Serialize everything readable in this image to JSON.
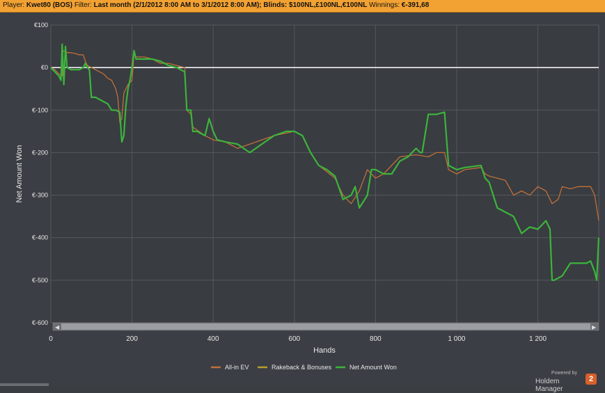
{
  "header": {
    "player_label": "Player:",
    "player_value": "Kwet80 (BOS)",
    "filter_label": "Filter:",
    "filter_value": "Last month (2/1/2012 8:00 AM to 3/1/2012 8:00 AM); Blinds: $100NL,£100NL,€100NL",
    "winnings_label": "Winnings:",
    "winnings_value": "€-391,68"
  },
  "branding": {
    "powered_by": "Powered by",
    "name": "Holdem Manager",
    "logo_glyph": "2"
  },
  "colors": {
    "background": "#3b3e44",
    "grid": "#55585d",
    "zero_line": "#ffffff",
    "all_in_ev": "#c0703a",
    "rakeback": "#b8a02a",
    "net_won": "#3cb43c",
    "header_bar": "#f2a233"
  },
  "chart_data": {
    "type": "line",
    "xlabel": "Hands",
    "ylabel": "Net Amount Won",
    "xlim": [
      0,
      1350
    ],
    "ylim": [
      -600,
      100
    ],
    "x_ticks": [
      0,
      200,
      400,
      600,
      800,
      1000,
      1200
    ],
    "x_tick_labels": [
      "0",
      "200",
      "400",
      "600",
      "800",
      "1 000",
      "1 200"
    ],
    "y_ticks": [
      100,
      0,
      -100,
      -200,
      -300,
      -400,
      -500,
      -600
    ],
    "y_tick_labels": [
      "€100",
      "€0",
      "€-100",
      "€-200",
      "€-300",
      "€-400",
      "€-500",
      "€-600"
    ],
    "grid": true,
    "legend_position": "bottom",
    "series": [
      {
        "name": "All-in EV",
        "color": "#c0703a",
        "points": [
          [
            0,
            0
          ],
          [
            10,
            -5
          ],
          [
            20,
            -15
          ],
          [
            28,
            -20
          ],
          [
            30,
            40
          ],
          [
            40,
            35
          ],
          [
            50,
            35
          ],
          [
            60,
            33
          ],
          [
            70,
            30
          ],
          [
            80,
            30
          ],
          [
            85,
            15
          ],
          [
            90,
            5
          ],
          [
            100,
            0
          ],
          [
            110,
            -5
          ],
          [
            120,
            -10
          ],
          [
            130,
            -15
          ],
          [
            140,
            -25
          ],
          [
            150,
            -30
          ],
          [
            160,
            -50
          ],
          [
            165,
            -70
          ],
          [
            170,
            -130
          ],
          [
            175,
            -120
          ],
          [
            180,
            -60
          ],
          [
            190,
            -40
          ],
          [
            200,
            -30
          ],
          [
            205,
            30
          ],
          [
            210,
            25
          ],
          [
            230,
            25
          ],
          [
            250,
            20
          ],
          [
            270,
            10
          ],
          [
            290,
            10
          ],
          [
            310,
            5
          ],
          [
            330,
            0
          ],
          [
            335,
            -100
          ],
          [
            345,
            -110
          ],
          [
            350,
            -140
          ],
          [
            380,
            -160
          ],
          [
            400,
            -170
          ],
          [
            430,
            -175
          ],
          [
            460,
            -190
          ],
          [
            490,
            -180
          ],
          [
            520,
            -170
          ],
          [
            550,
            -160
          ],
          [
            600,
            -150
          ],
          [
            620,
            -160
          ],
          [
            640,
            -200
          ],
          [
            660,
            -230
          ],
          [
            700,
            -260
          ],
          [
            720,
            -300
          ],
          [
            740,
            -320
          ],
          [
            760,
            -290
          ],
          [
            780,
            -240
          ],
          [
            800,
            -260
          ],
          [
            820,
            -250
          ],
          [
            860,
            -210
          ],
          [
            900,
            -205
          ],
          [
            930,
            -210
          ],
          [
            950,
            -200
          ],
          [
            970,
            -200
          ],
          [
            980,
            -240
          ],
          [
            1000,
            -250
          ],
          [
            1020,
            -240
          ],
          [
            1060,
            -235
          ],
          [
            1070,
            -250
          ],
          [
            1080,
            -255
          ],
          [
            1100,
            -260
          ],
          [
            1120,
            -265
          ],
          [
            1140,
            -300
          ],
          [
            1160,
            -290
          ],
          [
            1180,
            -300
          ],
          [
            1200,
            -280
          ],
          [
            1220,
            -290
          ],
          [
            1235,
            -320
          ],
          [
            1250,
            -310
          ],
          [
            1260,
            -280
          ],
          [
            1280,
            -285
          ],
          [
            1300,
            -280
          ],
          [
            1330,
            -280
          ],
          [
            1340,
            -300
          ],
          [
            1350,
            -360
          ]
        ]
      },
      {
        "name": "Rakeback & Bonuses",
        "color": "#b8a02a",
        "points": [
          [
            0,
            0
          ],
          [
            1350,
            0
          ]
        ]
      },
      {
        "name": "Net Amount Won",
        "color": "#3cb43c",
        "points": [
          [
            0,
            0
          ],
          [
            10,
            -10
          ],
          [
            20,
            -20
          ],
          [
            25,
            -30
          ],
          [
            28,
            55
          ],
          [
            32,
            -40
          ],
          [
            36,
            50
          ],
          [
            40,
            0
          ],
          [
            50,
            -5
          ],
          [
            60,
            -5
          ],
          [
            70,
            -5
          ],
          [
            80,
            0
          ],
          [
            85,
            10
          ],
          [
            90,
            0
          ],
          [
            95,
            -5
          ],
          [
            100,
            -70
          ],
          [
            110,
            -70
          ],
          [
            120,
            -75
          ],
          [
            130,
            -80
          ],
          [
            140,
            -85
          ],
          [
            150,
            -100
          ],
          [
            160,
            -100
          ],
          [
            170,
            -105
          ],
          [
            175,
            -175
          ],
          [
            180,
            -160
          ],
          [
            185,
            -90
          ],
          [
            190,
            -50
          ],
          [
            195,
            -30
          ],
          [
            200,
            0
          ],
          [
            205,
            40
          ],
          [
            210,
            20
          ],
          [
            230,
            20
          ],
          [
            250,
            20
          ],
          [
            270,
            15
          ],
          [
            290,
            5
          ],
          [
            310,
            0
          ],
          [
            330,
            -10
          ],
          [
            335,
            -100
          ],
          [
            345,
            -100
          ],
          [
            350,
            -150
          ],
          [
            360,
            -150
          ],
          [
            380,
            -160
          ],
          [
            390,
            -120
          ],
          [
            400,
            -150
          ],
          [
            410,
            -170
          ],
          [
            430,
            -175
          ],
          [
            460,
            -180
          ],
          [
            490,
            -200
          ],
          [
            520,
            -180
          ],
          [
            550,
            -160
          ],
          [
            580,
            -150
          ],
          [
            600,
            -150
          ],
          [
            620,
            -160
          ],
          [
            640,
            -200
          ],
          [
            660,
            -230
          ],
          [
            680,
            -240
          ],
          [
            700,
            -255
          ],
          [
            720,
            -310
          ],
          [
            740,
            -300
          ],
          [
            750,
            -280
          ],
          [
            760,
            -330
          ],
          [
            780,
            -300
          ],
          [
            790,
            -240
          ],
          [
            800,
            -240
          ],
          [
            820,
            -250
          ],
          [
            840,
            -250
          ],
          [
            860,
            -220
          ],
          [
            880,
            -210
          ],
          [
            900,
            -190
          ],
          [
            910,
            -200
          ],
          [
            915,
            -200
          ],
          [
            930,
            -110
          ],
          [
            950,
            -110
          ],
          [
            970,
            -105
          ],
          [
            980,
            -230
          ],
          [
            1000,
            -240
          ],
          [
            1020,
            -235
          ],
          [
            1060,
            -230
          ],
          [
            1070,
            -260
          ],
          [
            1080,
            -270
          ],
          [
            1090,
            -300
          ],
          [
            1100,
            -330
          ],
          [
            1120,
            -340
          ],
          [
            1140,
            -350
          ],
          [
            1160,
            -390
          ],
          [
            1180,
            -375
          ],
          [
            1200,
            -380
          ],
          [
            1220,
            -360
          ],
          [
            1230,
            -380
          ],
          [
            1235,
            -500
          ],
          [
            1240,
            -500
          ],
          [
            1260,
            -490
          ],
          [
            1280,
            -460
          ],
          [
            1300,
            -460
          ],
          [
            1320,
            -460
          ],
          [
            1330,
            -455
          ],
          [
            1340,
            -480
          ],
          [
            1345,
            -500
          ],
          [
            1350,
            -400
          ]
        ]
      }
    ]
  }
}
